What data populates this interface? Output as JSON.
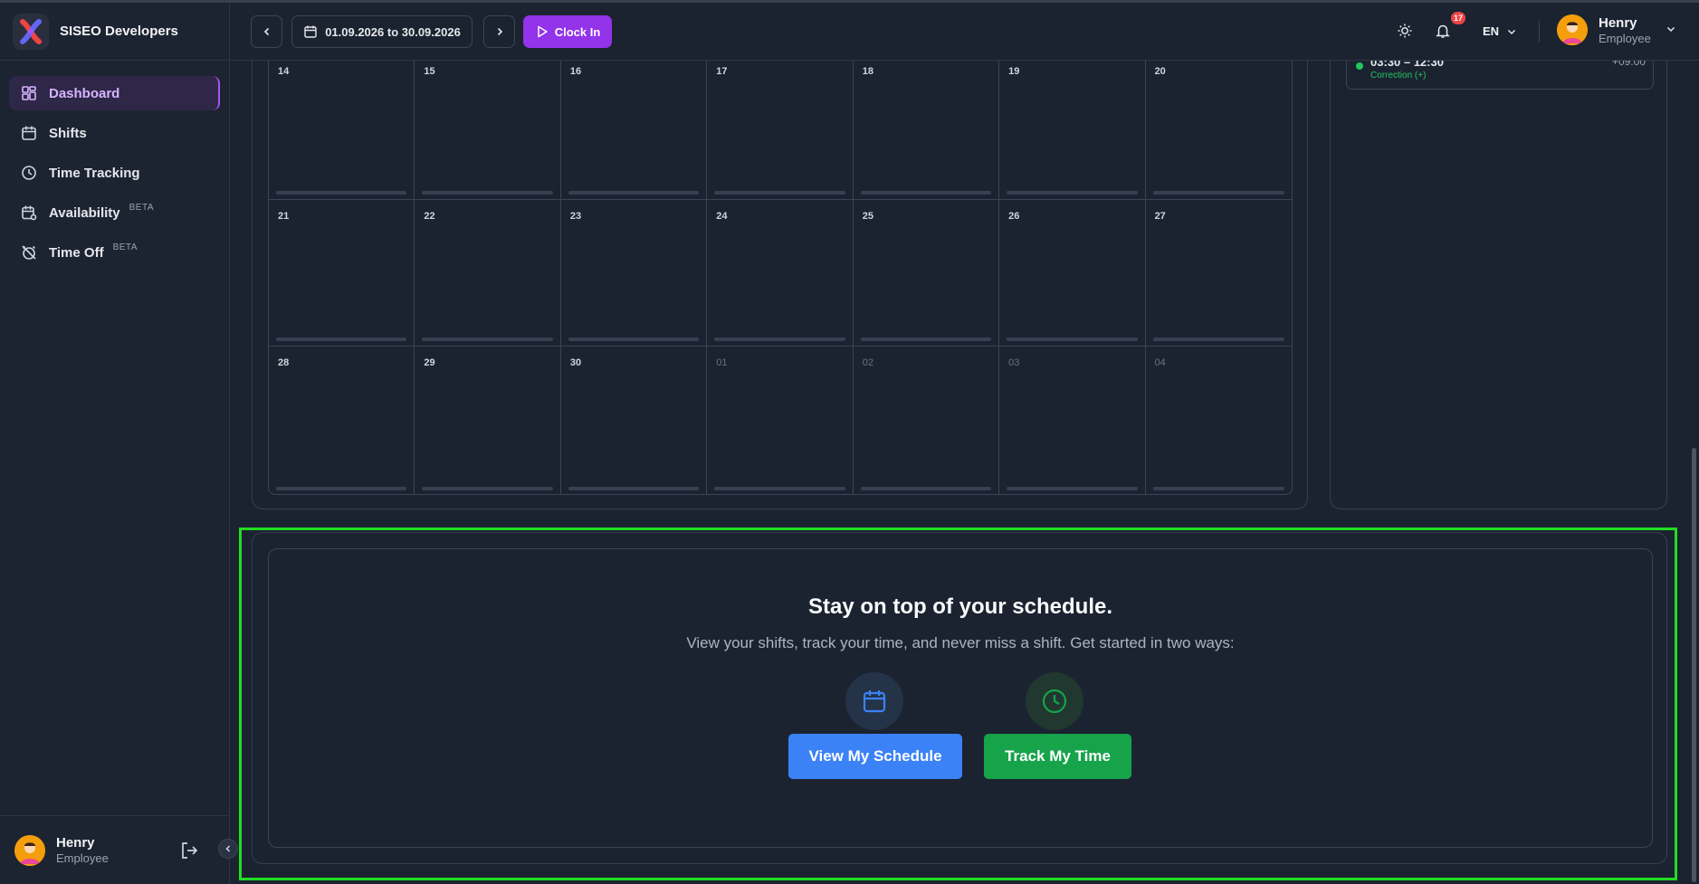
{
  "app": {
    "name": "SISEO Developers",
    "accent_color": "#9333ea"
  },
  "sidebar": {
    "items": [
      {
        "label": "Dashboard",
        "icon": "dashboard-icon",
        "active": true
      },
      {
        "label": "Shifts",
        "icon": "calendar-icon"
      },
      {
        "label": "Time Tracking",
        "icon": "clock-icon"
      },
      {
        "label": "Availability",
        "icon": "calendar-settings-icon",
        "badge": "BETA"
      },
      {
        "label": "Time Off",
        "icon": "alarm-off-icon",
        "badge": "BETA"
      }
    ],
    "user": {
      "name": "Henry",
      "role": "Employee"
    }
  },
  "header": {
    "date_range": "01.09.2026 to 30.09.2026",
    "clock_in_label": "Clock In",
    "notification_count": "17",
    "language": "EN",
    "user": {
      "name": "Henry",
      "role": "Employee"
    }
  },
  "calendar": {
    "days": [
      {
        "label": "14",
        "muted": false
      },
      {
        "label": "15",
        "muted": false
      },
      {
        "label": "16",
        "muted": false
      },
      {
        "label": "17",
        "muted": false
      },
      {
        "label": "18",
        "muted": false
      },
      {
        "label": "19",
        "muted": false
      },
      {
        "label": "20",
        "muted": false
      },
      {
        "label": "21",
        "muted": false
      },
      {
        "label": "22",
        "muted": false
      },
      {
        "label": "23",
        "muted": false
      },
      {
        "label": "24",
        "muted": false
      },
      {
        "label": "25",
        "muted": false
      },
      {
        "label": "26",
        "muted": false
      },
      {
        "label": "27",
        "muted": false
      },
      {
        "label": "28",
        "muted": false
      },
      {
        "label": "29",
        "muted": false
      },
      {
        "label": "30",
        "muted": false
      },
      {
        "label": "01",
        "muted": true
      },
      {
        "label": "02",
        "muted": true
      },
      {
        "label": "03",
        "muted": true
      },
      {
        "label": "04",
        "muted": true
      }
    ]
  },
  "time_entries": {
    "entry": {
      "time": "03:30 – 12:30",
      "diff": "+09:00",
      "tag": "Correction (+)"
    }
  },
  "welcome": {
    "title": "Stay on top of your schedule.",
    "subtitle": "View your shifts, track your time, and never miss a shift. Get started in two ways:",
    "schedule_button": "View My Schedule",
    "track_button": "Track My Time",
    "schedule_color": "#3b82f6",
    "track_color": "#16a34a"
  }
}
